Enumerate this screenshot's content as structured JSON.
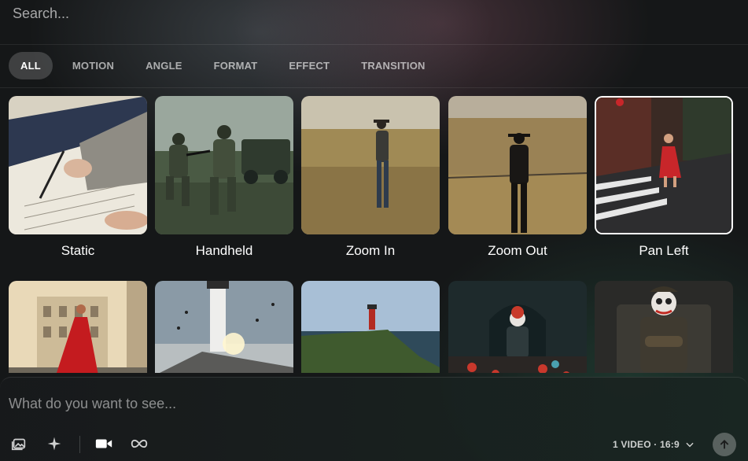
{
  "search": {
    "placeholder": "Search..."
  },
  "filters": [
    {
      "label": "ALL",
      "active": true
    },
    {
      "label": "MOTION",
      "active": false
    },
    {
      "label": "ANGLE",
      "active": false
    },
    {
      "label": "FORMAT",
      "active": false
    },
    {
      "label": "EFFECT",
      "active": false
    },
    {
      "label": "TRANSITION",
      "active": false
    }
  ],
  "cards": [
    {
      "label": "Static"
    },
    {
      "label": "Handheld"
    },
    {
      "label": "Zoom In"
    },
    {
      "label": "Zoom Out"
    },
    {
      "label": "Pan Left"
    },
    {
      "label": ""
    },
    {
      "label": ""
    },
    {
      "label": ""
    },
    {
      "label": ""
    },
    {
      "label": ""
    }
  ],
  "composer": {
    "placeholder": "What do you want to see...",
    "settings_label": "1 VIDEO · 16:9"
  },
  "icons": {
    "image": "image-icon",
    "sparkle": "sparkle-icon",
    "video": "video-camera-icon",
    "loop": "infinity-icon",
    "chevron": "chevron-down-icon",
    "submit": "arrow-up-icon"
  }
}
